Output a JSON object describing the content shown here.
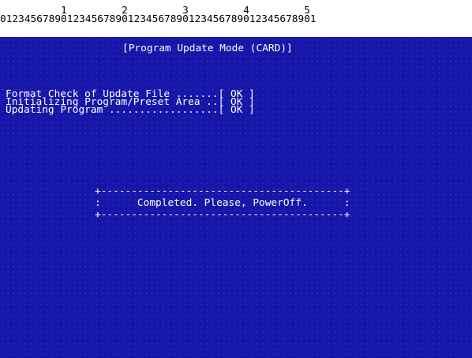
{
  "ruler": {
    "tens": "          1         2         3         4         5",
    "ones": "0123456789012345678901234567890123456789012345678901"
  },
  "screen": {
    "title": "[Program Update Mode (CARD)]",
    "steps": [
      {
        "text": "Format Check of Update File .......[ OK ]"
      },
      {
        "text": "Initializing Program/Preset Area ..[ OK ]"
      },
      {
        "text": "Updating Program ..................[ OK ]"
      }
    ],
    "message_box": {
      "top_border": "+----------------------------------------+",
      "message": ":      Completed. Please, PowerOff.      :",
      "bottom_border": "+----------------------------------------+"
    }
  },
  "colors": {
    "background": "#1616a8",
    "text": "#ffffff",
    "ruler_bg": "#ffffff",
    "ruler_text": "#000000"
  }
}
